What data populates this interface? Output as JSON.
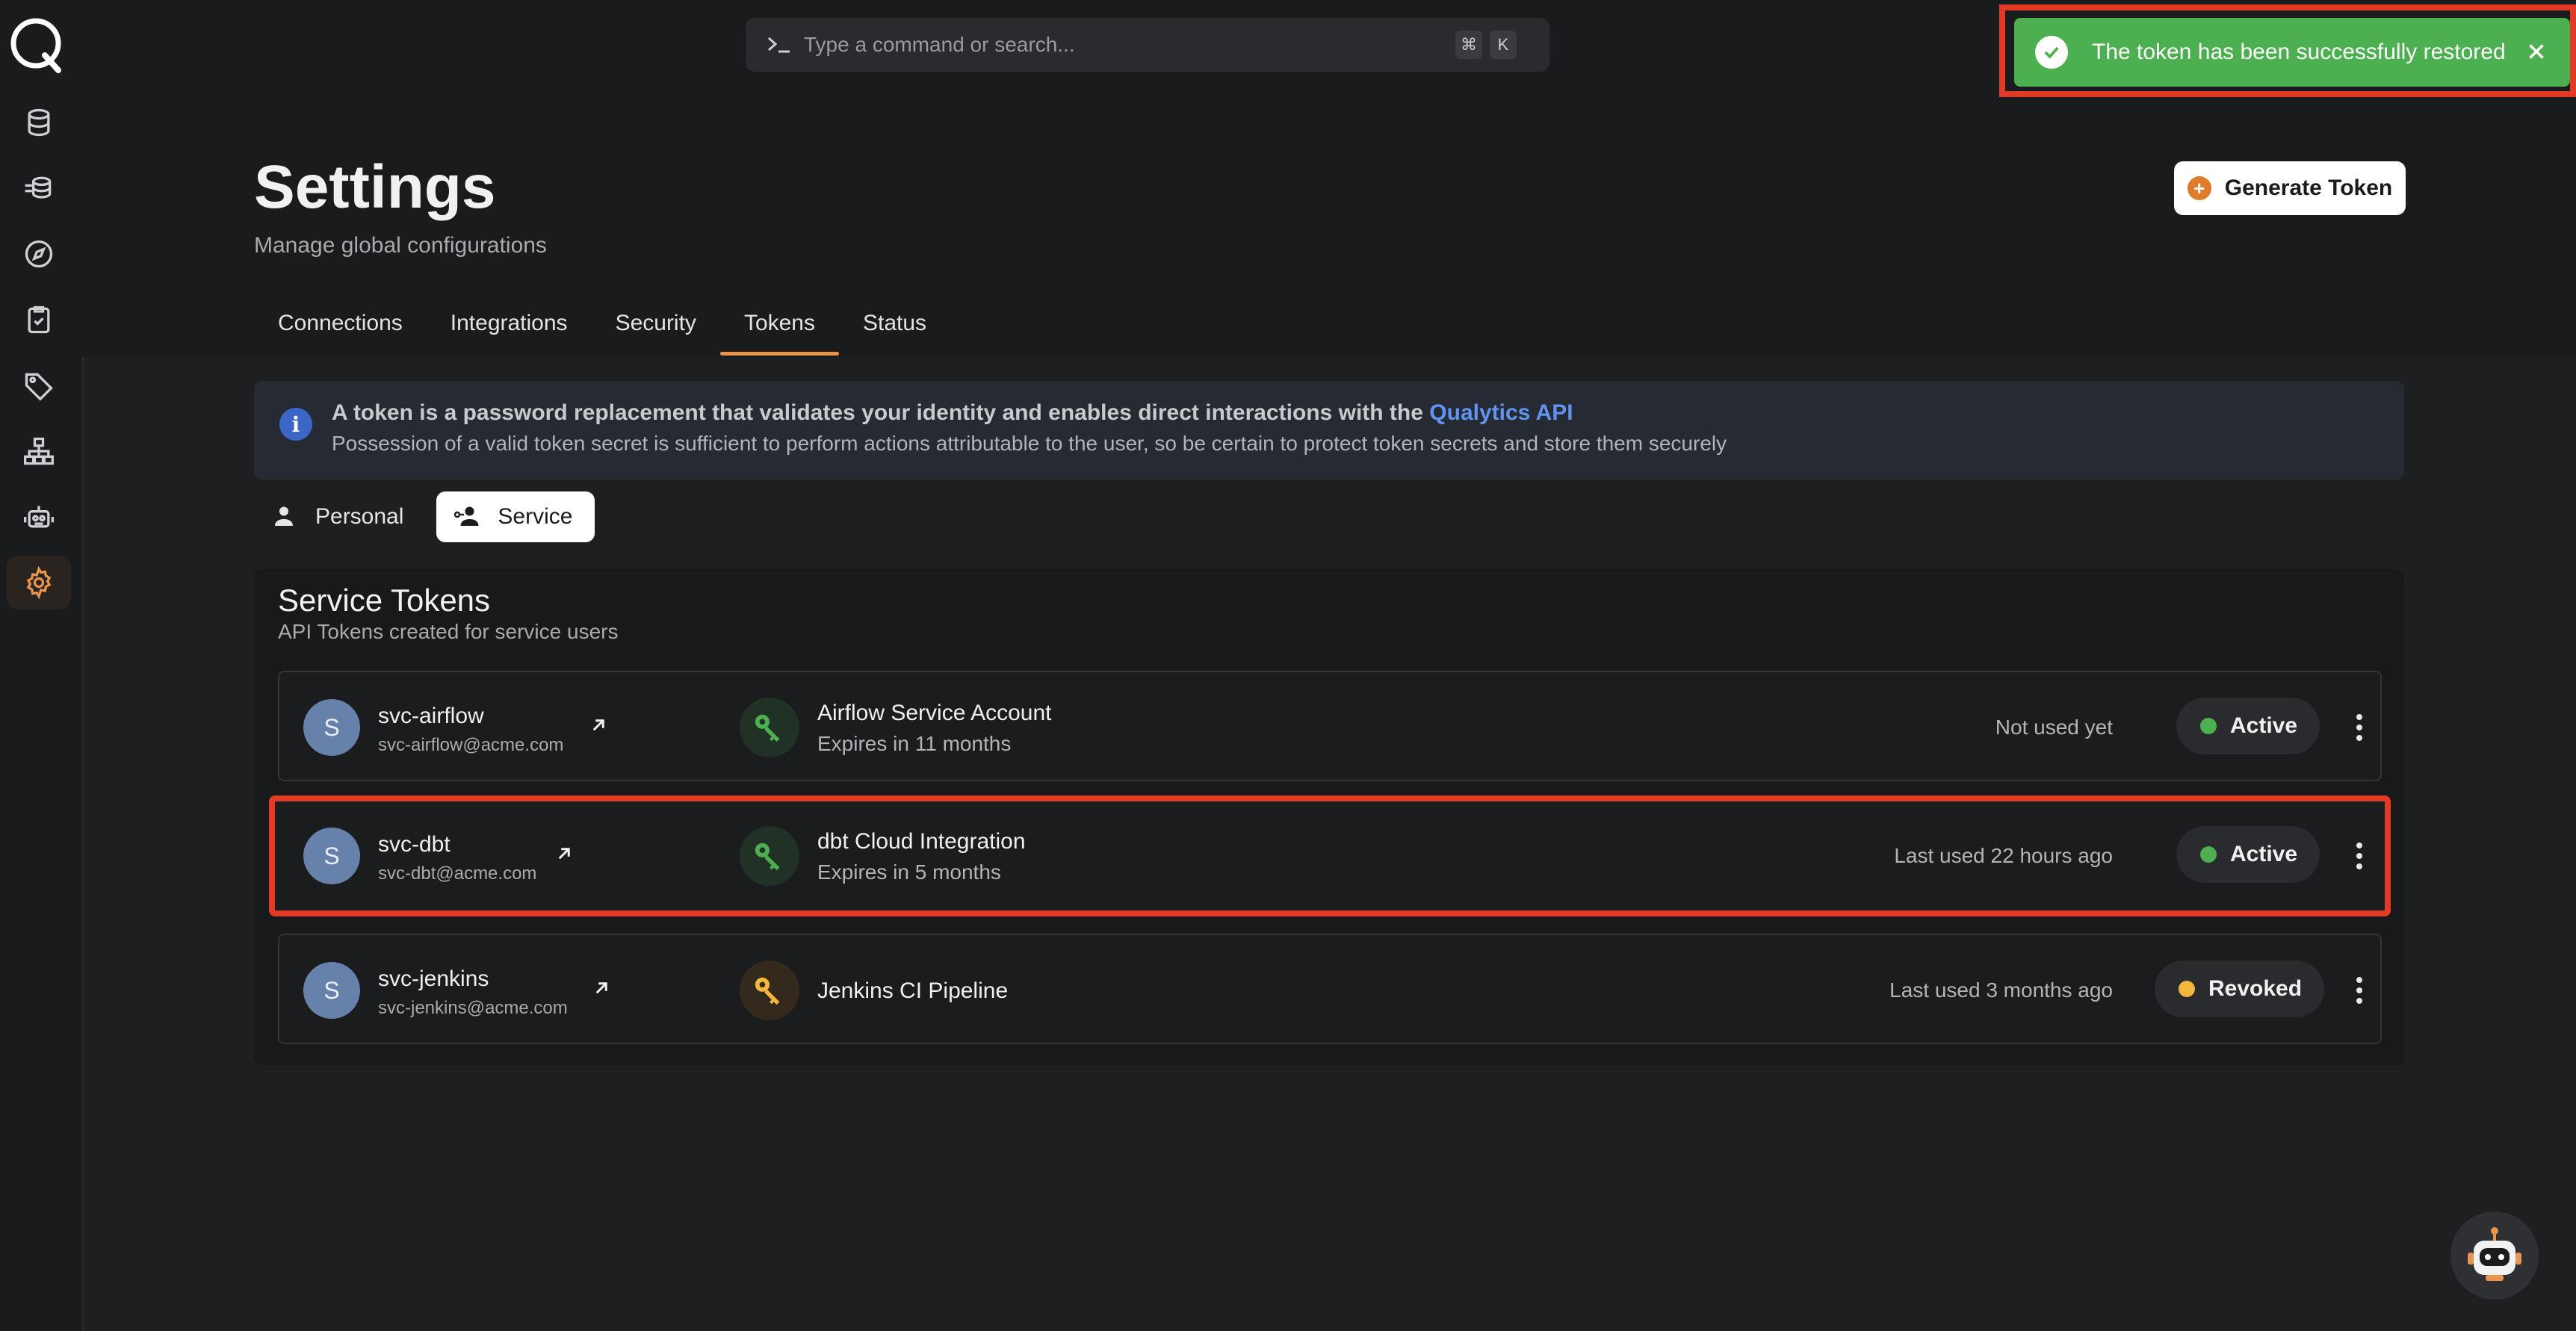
{
  "topbar": {
    "command_placeholder": "Type a command or search...",
    "shortcut_key1": "⌘",
    "shortcut_key2": "K"
  },
  "sidebar": {
    "items": [
      {
        "icon": "database-icon"
      },
      {
        "icon": "data-stack-icon"
      },
      {
        "icon": "compass-icon"
      },
      {
        "icon": "clipboard-check-icon"
      },
      {
        "icon": "tag-icon"
      },
      {
        "icon": "hierarchy-icon"
      },
      {
        "icon": "robot-icon"
      },
      {
        "icon": "gear-icon",
        "active": true
      }
    ]
  },
  "header": {
    "title": "Settings",
    "subtitle": "Manage global configurations",
    "generate_button": "Generate Token",
    "tabs": [
      "Connections",
      "Integrations",
      "Security",
      "Tokens",
      "Status"
    ],
    "active_tab": "Tokens"
  },
  "info": {
    "line1": "A token is a password replacement that validates your identity and enables direct interactions with the ",
    "link": "Qualytics API",
    "line2": "Possession of a valid token secret is sufficient to perform actions attributable to the user, so be certain to protect token secrets and store them securely"
  },
  "segment": {
    "personal": "Personal",
    "service": "Service",
    "active": "Service"
  },
  "tokens": {
    "title": "Service Tokens",
    "subtitle": "API Tokens created for service users",
    "rows": [
      {
        "initial": "S",
        "user": "svc-airflow",
        "email": "svc-airflow@acme.com",
        "name": "Airflow Service Account",
        "expires": "Expires in 11 months",
        "usage": "Not used yet",
        "status": "Active",
        "status_color": "#4caf50"
      },
      {
        "initial": "S",
        "user": "svc-dbt",
        "email": "svc-dbt@acme.com",
        "name": "dbt Cloud Integration",
        "expires": "Expires in 5 months",
        "usage": "Last used 22 hours ago",
        "status": "Active",
        "status_color": "#4caf50"
      },
      {
        "initial": "S",
        "user": "svc-jenkins",
        "email": "svc-jenkins@acme.com",
        "name": "Jenkins CI Pipeline",
        "expires": "",
        "usage": "Last used 3 months ago",
        "status": "Revoked",
        "status_color": "#f5b73b"
      }
    ]
  },
  "toast": {
    "message": "The token has been successfully restored"
  },
  "colors": {
    "accent": "#e9954c",
    "success": "#4caf50",
    "warning": "#f5b73b",
    "highlight": "#e23a24"
  }
}
